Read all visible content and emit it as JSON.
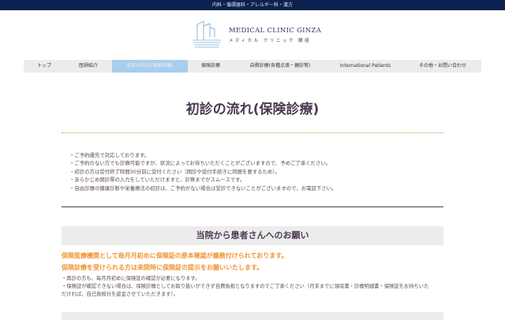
{
  "topbar": {
    "text": "内科・循環器科・アレルギー科・漢方"
  },
  "logo": {
    "name_en": "MEDICAL CLINIC GINZA",
    "name_jp": "メディカル クリニック 銀座"
  },
  "nav": [
    {
      "label": "トップ"
    },
    {
      "label": "医師紹介"
    },
    {
      "label": "初診の流れ(保険診療)",
      "active": true
    },
    {
      "label": "保険診療"
    },
    {
      "label": "自費診療(各種点滴・健診等)"
    },
    {
      "label": "International Patients"
    },
    {
      "label": "その他・お問い合わせ"
    }
  ],
  "page_title": "初診の流れ(保険診療)",
  "bullets": [
    "・ご予約優先で対応しております。",
    "・ご予約のない方でも診療可能ですが、状況によってお待ちいただくことがございますので、予めご了承ください。",
    "・初診の方は受付終了時間30分前に受付ください（問診や受付手続きに時間を要するため）。",
    "・あらかじめ問診票の入力をしていただけますと、診察までがスムースです。",
    "・自由診療の健康診断や栄養療法の初診は、ご予約がない場合は受診できないことがございますので、お電話下さい。"
  ],
  "request": {
    "heading": "当院から患者さんへのお願い",
    "highlights": [
      "保険医療機関として毎月月初めに保険証の原本確認が義務付けられております。",
      "保険診療を受けられる方は来院時に保険証の提示をお願いいたします。"
    ],
    "notes": [
      "・再診の方も、毎月月初めに保険証の確認が必要になります。",
      "・保険証が確認できない場合は、保険診療としてお取り扱いができず自費負担となりますのでご了承ください（月末までに領収書・診療明細書・保険証をお持ちいただければ、自己負担分を返金させていただきます）。"
    ]
  }
}
